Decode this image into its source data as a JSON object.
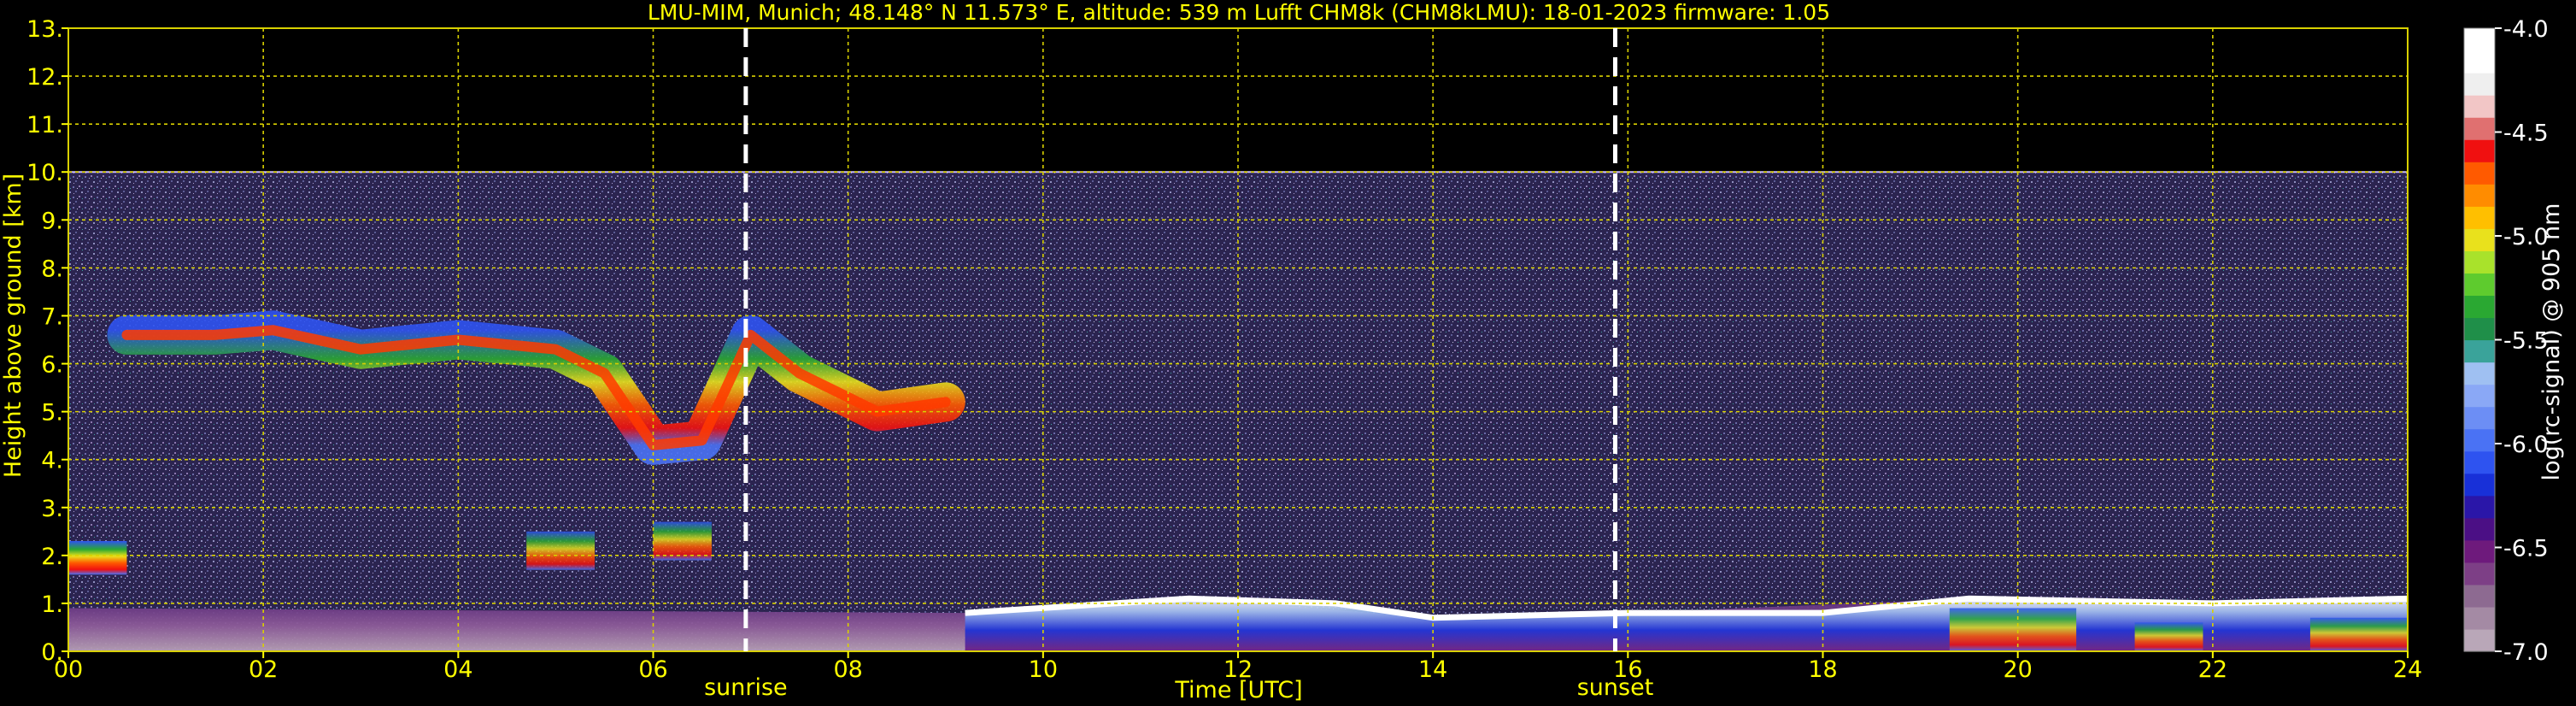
{
  "chart_data": {
    "type": "heatmap",
    "title": "LMU-MIM, Munich; 48.148° N 11.573° E, altitude: 539 m    Lufft CHM8k (CHM8kLMU): 18-01-2023    firmware: 1.05",
    "xlabel": "Time [UTC]",
    "ylabel": "Height above ground [km]",
    "xlim": [
      0,
      24
    ],
    "ylim": [
      0,
      13
    ],
    "x_ticks": [
      "00",
      "02",
      "04",
      "06",
      "08",
      "10",
      "12",
      "14",
      "16",
      "18",
      "20",
      "22",
      "24"
    ],
    "y_ticks": [
      "0.",
      "1.",
      "2.",
      "3.",
      "4.",
      "5.",
      "6.",
      "7.",
      "8.",
      "9.",
      "10.",
      "11.",
      "12.",
      "13."
    ],
    "grid": true,
    "colorbar": {
      "label": "log(rc-signal) @ 905 nm",
      "range": [
        -7.0,
        -4.0
      ],
      "ticks": [
        "-4.0",
        "-4.5",
        "-5.0",
        "-5.5",
        "-6.0",
        "-6.5",
        "-7.0"
      ],
      "colors": [
        "#b9a7b8",
        "#a48aa4",
        "#8d6a91",
        "#7d3f86",
        "#6e1a7c",
        "#4b0f85",
        "#2a16a8",
        "#1830d8",
        "#2e53f0",
        "#4a72f4",
        "#6c8ef5",
        "#8aa8f6",
        "#9fc0f2",
        "#3aa39a",
        "#1f8f49",
        "#2aa832",
        "#5ecb2e",
        "#a9e22b",
        "#e9e11c",
        "#ffbf00",
        "#ff8c00",
        "#ff5a00",
        "#f01010",
        "#e07070",
        "#f2c6c6",
        "#efefef",
        "#ffffff",
        "#ffffff"
      ]
    },
    "event_lines": [
      {
        "name": "sunrise",
        "x": 6.95
      },
      {
        "name": "sunset",
        "x": 15.87
      }
    ],
    "features": {
      "noise_floor_top_km": 10.0,
      "cloud_layer_midlevel": [
        {
          "x": 0.6,
          "y": 6.6
        },
        {
          "x": 1.5,
          "y": 6.6
        },
        {
          "x": 2.1,
          "y": 6.7
        },
        {
          "x": 3.0,
          "y": 6.3
        },
        {
          "x": 4.0,
          "y": 6.5
        },
        {
          "x": 5.0,
          "y": 6.3
        },
        {
          "x": 5.5,
          "y": 5.8
        },
        {
          "x": 6.0,
          "y": 4.3
        },
        {
          "x": 6.5,
          "y": 4.4
        },
        {
          "x": 7.0,
          "y": 6.6
        },
        {
          "x": 7.5,
          "y": 5.8
        },
        {
          "x": 8.3,
          "y": 5.0
        },
        {
          "x": 9.0,
          "y": 5.2
        }
      ],
      "boundary_layer_top_km": [
        {
          "x": 0,
          "y": 0.9
        },
        {
          "x": 9.2,
          "y": 0.8
        },
        {
          "x": 11.5,
          "y": 1.1
        },
        {
          "x": 14,
          "y": 0.7
        },
        {
          "x": 16,
          "y": 0.8
        },
        {
          "x": 19.5,
          "y": 1.1
        },
        {
          "x": 22,
          "y": 1.0
        },
        {
          "x": 24,
          "y": 1.1
        }
      ]
    }
  }
}
